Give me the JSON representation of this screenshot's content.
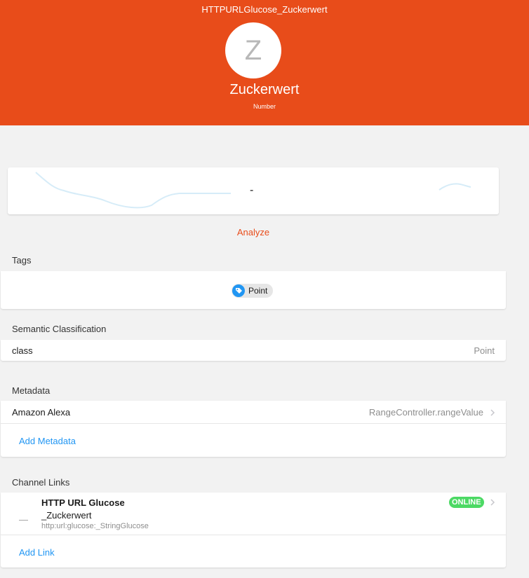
{
  "header": {
    "item_name": "HTTPURLGlucose_Zuckerwert",
    "avatar_letter": "Z",
    "label": "Zuckerwert",
    "type": "Number",
    "color": "#e84c1a"
  },
  "chart": {
    "state": "-"
  },
  "analyze_label": "Analyze",
  "tags": {
    "title": "Tags",
    "items": [
      {
        "label": "Point",
        "icon": "tag-icon"
      }
    ]
  },
  "semantic": {
    "title": "Semantic Classification",
    "label": "class",
    "value": "Point"
  },
  "metadata": {
    "title": "Metadata",
    "items": [
      {
        "label": "Amazon Alexa",
        "value": "RangeController.rangeValue"
      }
    ],
    "add_label": "Add Metadata"
  },
  "channel_links": {
    "title": "Channel Links",
    "items": [
      {
        "thing": "HTTP URL Glucose",
        "channel": "_Zuckerwert",
        "uid": "http:url:glucose:_StringGlucose",
        "status": "ONLINE",
        "state": "—"
      }
    ],
    "add_label": "Add Link"
  }
}
